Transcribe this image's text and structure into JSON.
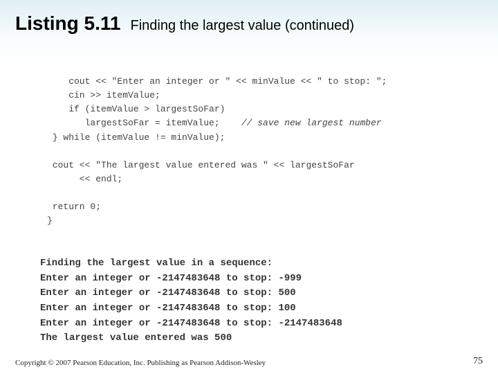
{
  "header": {
    "listing_label": "Listing 5.11",
    "caption": "Finding the largest value (continued)"
  },
  "code": {
    "l1": "    cout << \"Enter an integer or \" << minValue << \" to stop: \";",
    "l2": "    cin >> itemValue;",
    "l3": "    if (itemValue > largestSoFar)",
    "l4_code": "       largestSoFar = itemValue;",
    "l4_comment": "    // save new largest number",
    "l5": " } while (itemValue != minValue);",
    "l6": "",
    "l7": " cout << \"The largest value entered was \" << largestSoFar",
    "l8": "      << endl;",
    "l9": "",
    "l10": " return 0;",
    "l11": "}"
  },
  "output": {
    "o1": "Finding the largest value in a sequence:",
    "o2": "Enter an integer or -2147483648 to stop: -999",
    "o3": "Enter an integer or -2147483648 to stop: 500",
    "o4": "Enter an integer or -2147483648 to stop: 100",
    "o5": "Enter an integer or -2147483648 to stop: -2147483648",
    "o6": "The largest value entered was 500"
  },
  "footer": {
    "copyright": "Copyright © 2007 Pearson Education, Inc. Publishing as Pearson Addison-Wesley",
    "page": "75"
  }
}
